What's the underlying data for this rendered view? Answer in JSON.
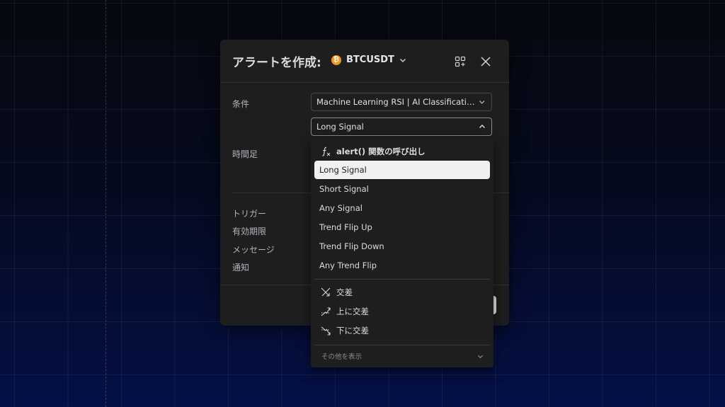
{
  "dialog": {
    "title": "アラートを作成:",
    "symbol": "BTCUSDT",
    "symbol_icon_glyph": "₿",
    "icons": {
      "presets": "presets-icon",
      "close": "close-icon"
    }
  },
  "form": {
    "condition_label": "条件",
    "condition_value": "Machine Learning RSI | AI Classification ...",
    "signal_value": "Long Signal",
    "timeframe_label": "時間足",
    "trigger_label": "トリガー",
    "expiration_label": "有効期限",
    "message_label": "メッセージ",
    "notification_label": "通知"
  },
  "menu": {
    "fx_item": "alert() 関数の呼び出し",
    "items": [
      {
        "label": "Long Signal",
        "selected": true
      },
      {
        "label": "Short Signal",
        "selected": false
      },
      {
        "label": "Any Signal",
        "selected": false
      },
      {
        "label": "Trend Flip Up",
        "selected": false
      },
      {
        "label": "Trend Flip Down",
        "selected": false
      },
      {
        "label": "Any Trend Flip",
        "selected": false
      }
    ],
    "cross_items": [
      {
        "label": "交差",
        "icon": "crossing-icon"
      },
      {
        "label": "上に交差",
        "icon": "crossing-up-icon"
      },
      {
        "label": "下に交差",
        "icon": "crossing-down-icon"
      }
    ],
    "show_more": "その他を表示"
  },
  "colors": {
    "accent_btc": "#f7931a",
    "dialog_bg": "#1e1e1e",
    "selected_bg": "#f0f0f0"
  }
}
